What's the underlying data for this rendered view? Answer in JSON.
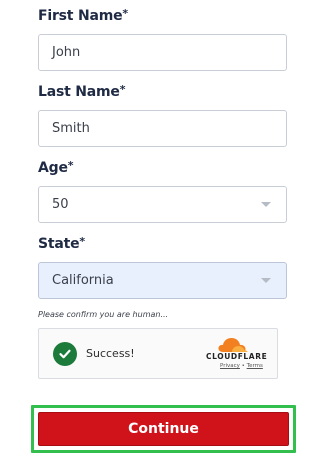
{
  "form": {
    "first_name": {
      "label": "First Name",
      "required_mark": "*",
      "value": "John"
    },
    "last_name": {
      "label": "Last Name",
      "required_mark": "*",
      "value": "Smith"
    },
    "age": {
      "label": "Age",
      "required_mark": "*",
      "selected": "50"
    },
    "state": {
      "label": "State",
      "required_mark": "*",
      "selected": "California"
    }
  },
  "captcha": {
    "hint": "Please confirm you are human...",
    "status": "Success!",
    "brand": "CLOUDFLARE",
    "privacy_link": "Privacy",
    "separator": "•",
    "terms_link": "Terms",
    "icons": {
      "status": "check-circle-icon",
      "brand": "cloudflare-logo"
    },
    "colors": {
      "success": "#1c7a3a",
      "brand_orange": "#f38020"
    }
  },
  "actions": {
    "continue_label": "Continue",
    "colors": {
      "button": "#d0121b",
      "highlight": "#33bf4d"
    }
  }
}
